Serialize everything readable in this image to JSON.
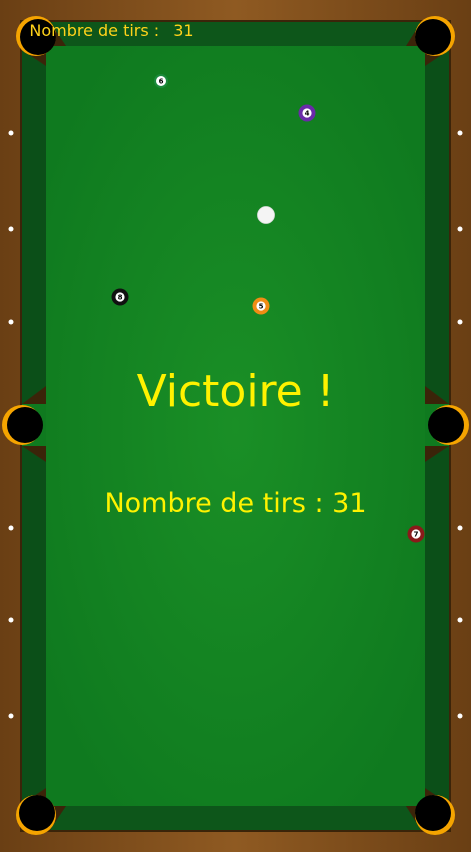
{
  "hud": {
    "label": "Nombre de tirs :",
    "value": "31"
  },
  "message": {
    "title": "Victoire !",
    "subtitle": "Nombre de tirs : 31"
  },
  "colors": {
    "rail": "#8a5520",
    "felt": "#168a23",
    "cushion": "#0f5b1b",
    "pocket": "#000000",
    "pocket_rim": "#f5a400",
    "text": "#fff200"
  },
  "balls": [
    {
      "kind": "cue",
      "number": "",
      "color": "#f4f4f4"
    },
    {
      "kind": "solid",
      "number": "4",
      "color": "#6a2aa8"
    },
    {
      "kind": "stripe",
      "number": "6",
      "color": "#1c8a3c"
    },
    {
      "kind": "solid",
      "number": "8",
      "color": "#111111"
    },
    {
      "kind": "solid",
      "number": "5",
      "color": "#f08c14"
    },
    {
      "kind": "solid",
      "number": "7",
      "color": "#8a1a1a"
    }
  ]
}
